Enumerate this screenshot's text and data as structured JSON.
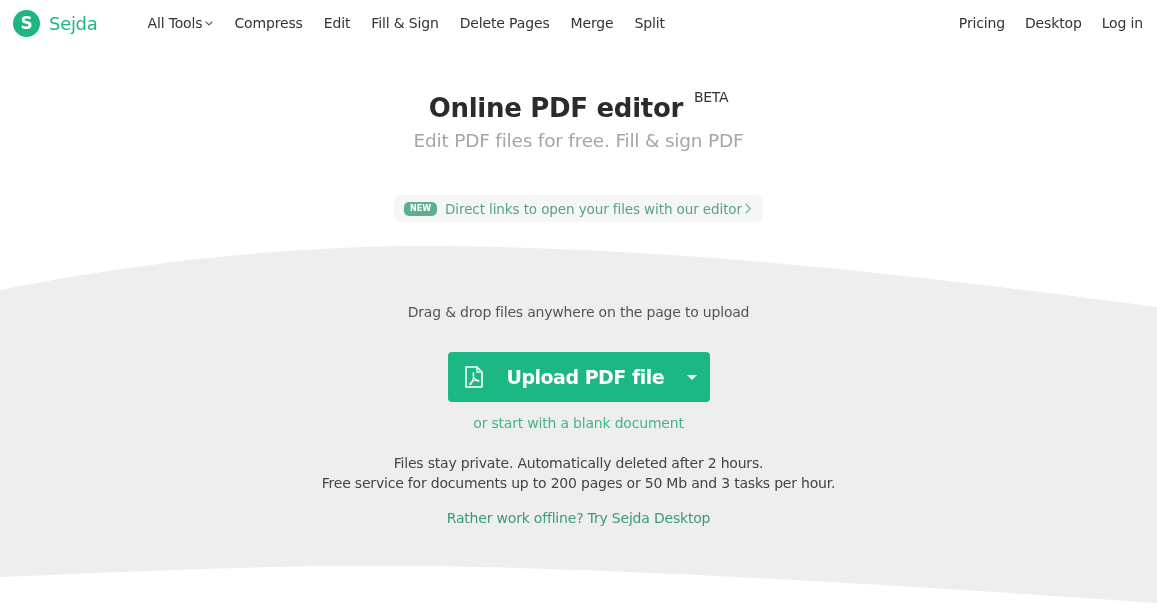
{
  "nav": {
    "logo": {
      "mark": "S",
      "text": "Sejda"
    },
    "items": [
      {
        "label": "All Tools",
        "dropdown": true
      },
      {
        "label": "Compress",
        "dropdown": false
      },
      {
        "label": "Edit",
        "dropdown": false
      },
      {
        "label": "Fill & Sign",
        "dropdown": false
      },
      {
        "label": "Delete Pages",
        "dropdown": false
      },
      {
        "label": "Merge",
        "dropdown": false
      },
      {
        "label": "Split",
        "dropdown": false
      }
    ],
    "right_items": [
      "Pricing",
      "Desktop",
      "Log in"
    ]
  },
  "hero": {
    "title": "Online PDF editor",
    "badge": "BETA",
    "subtitle": "Edit PDF files for free. Fill & sign PDF",
    "announcement": {
      "tag": "NEW",
      "text": "Direct links to open your files with our editor"
    }
  },
  "upload": {
    "hint": "Drag & drop files anywhere on the page to upload",
    "button": "Upload PDF file",
    "alt_link": "or start with a blank document",
    "notes": [
      "Files stay private. Automatically deleted after 2 hours.",
      "Free service for documents up to 200 pages or 50 Mb and 3 tasks per hour."
    ],
    "desktop_link": "Rather work offline? Try Sejda Desktop"
  }
}
